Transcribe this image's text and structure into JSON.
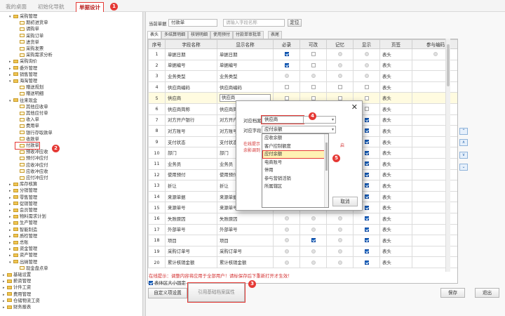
{
  "topbar": {
    "tabs": [
      {
        "label": "我的桌面"
      },
      {
        "label": "初始化导航"
      },
      {
        "label": "单据设计"
      }
    ]
  },
  "markers": [
    "1",
    "2",
    "3",
    "4",
    "5"
  ],
  "tree": [
    {
      "label": "采购管理",
      "level": 1,
      "folder": true,
      "open": true
    },
    {
      "label": "期初进货单",
      "level": 2
    },
    {
      "label": "请购单",
      "level": 2
    },
    {
      "label": "采购订单",
      "level": 2
    },
    {
      "label": "进货单",
      "level": 2
    },
    {
      "label": "采购发票",
      "level": 2
    },
    {
      "label": "采购需求分析",
      "level": 2
    },
    {
      "label": "采购询价",
      "level": 1,
      "folder": true
    },
    {
      "label": "委外管理",
      "level": 1,
      "folder": true
    },
    {
      "label": "销售管理",
      "level": 1,
      "folder": true
    },
    {
      "label": "海淘管理",
      "level": 1,
      "folder": true,
      "open": true
    },
    {
      "label": "赠送规划",
      "level": 2
    },
    {
      "label": "赠送明细",
      "level": 2
    },
    {
      "label": "往来现金",
      "level": 1,
      "folder": true,
      "open": true
    },
    {
      "label": "其他应收单",
      "level": 2
    },
    {
      "label": "其他应付单",
      "level": 2
    },
    {
      "label": "收入单",
      "level": 2
    },
    {
      "label": "费用单",
      "level": 2
    },
    {
      "label": "银行存取款单",
      "level": 2
    },
    {
      "label": "收款单",
      "level": 2
    },
    {
      "label": "付款单",
      "level": 2,
      "highlight": true
    },
    {
      "label": "预收冲应收",
      "level": 2
    },
    {
      "label": "预付冲应付",
      "level": 2
    },
    {
      "label": "应收冲应付",
      "level": 2
    },
    {
      "label": "应收冲应收",
      "level": 2
    },
    {
      "label": "应付冲应付",
      "level": 2
    },
    {
      "label": "库存核算",
      "level": 1,
      "folder": true
    },
    {
      "label": "分销管理",
      "level": 1,
      "folder": true
    },
    {
      "label": "零售管理",
      "level": 1,
      "folder": true
    },
    {
      "label": "促销管理",
      "level": 1,
      "folder": true
    },
    {
      "label": "会员管理",
      "level": 1,
      "folder": true
    },
    {
      "label": "物料需求计划",
      "level": 1,
      "folder": true
    },
    {
      "label": "生产管理",
      "level": 1,
      "folder": true
    },
    {
      "label": "智能制造",
      "level": 1,
      "folder": true
    },
    {
      "label": "质检管理",
      "level": 1,
      "folder": true
    },
    {
      "label": "总账",
      "level": 1,
      "folder": true
    },
    {
      "label": "资金管理",
      "level": 1,
      "folder": true
    },
    {
      "label": "资产管理",
      "level": 1,
      "folder": true
    },
    {
      "label": "出纳管理",
      "level": 1,
      "folder": true,
      "open": true
    },
    {
      "label": "现金盘点单",
      "level": 2
    },
    {
      "label": "基础设置",
      "level": 0,
      "folder": true
    },
    {
      "label": "薪资管理",
      "level": 0,
      "folder": true
    },
    {
      "label": "计件工资",
      "level": 0,
      "folder": true
    },
    {
      "label": "费用管理",
      "level": 0,
      "folder": true
    },
    {
      "label": "仓储物流工资",
      "level": 0,
      "folder": true
    },
    {
      "label": "财务报表",
      "level": 0,
      "folder": true
    }
  ],
  "main": {
    "doc_type_label": "当前单据",
    "doc_type_value": "付款单",
    "search_placeholder": "请输入字段名称",
    "locate_button": "定位",
    "subtabs": [
      "表头",
      "多结算明细",
      "核销明细",
      "使用预付",
      "付款单审批单",
      "表尾"
    ],
    "columns": [
      "序号",
      "字段名称",
      "显示名称",
      "必录",
      "可改",
      "记忆",
      "显示",
      "页签",
      "参与编码"
    ],
    "rows": [
      {
        "no": "1",
        "field": "单据日期",
        "display": "单据日期",
        "req": "on",
        "edit": "",
        "mem": "dis",
        "show": "dis",
        "tab": "表头",
        "code": "dis"
      },
      {
        "no": "2",
        "field": "单据编号",
        "display": "单据编号",
        "req": "on",
        "edit": "",
        "mem": "dis",
        "show": "dis",
        "tab": "表头",
        "code": ""
      },
      {
        "no": "3",
        "field": "业务类型",
        "display": "业务类型",
        "req": "dis",
        "edit": "dis",
        "mem": "dis",
        "show": "dis",
        "tab": "表头",
        "code": ""
      },
      {
        "no": "4",
        "field": "供应商编码",
        "display": "供应商编码",
        "req": "",
        "edit": "",
        "mem": "",
        "show": "",
        "tab": "表头",
        "code": ""
      },
      {
        "no": "5",
        "field": "供应商",
        "display": "供应商",
        "req": "",
        "edit": "",
        "mem": "",
        "show": "",
        "tab": "表头",
        "code": "",
        "selected": true
      },
      {
        "no": "6",
        "field": "供应商简称",
        "display": "供应商简称",
        "req": "",
        "edit": "",
        "mem": "",
        "show": "",
        "tab": "表头",
        "code": ""
      },
      {
        "no": "7",
        "field": "对方开户银行",
        "display": "对方开户银行",
        "req": "",
        "edit": "",
        "mem": "",
        "show": "on",
        "tab": "表头",
        "code": ""
      },
      {
        "no": "8",
        "field": "对方账号",
        "display": "对方账号",
        "req": "",
        "edit": "",
        "mem": "",
        "show": "on",
        "tab": "表头",
        "code": ""
      },
      {
        "no": "9",
        "field": "支付状态",
        "display": "支付状态",
        "req": "",
        "edit": "",
        "mem": "",
        "show": "on",
        "tab": "表头",
        "code": ""
      },
      {
        "no": "10",
        "field": "部门",
        "display": "部门",
        "req": "",
        "edit": "",
        "mem": "",
        "show": "on",
        "tab": "表头",
        "code": ""
      },
      {
        "no": "11",
        "field": "业务员",
        "display": "业务员",
        "req": "",
        "edit": "",
        "mem": "",
        "show": "on",
        "tab": "表头",
        "code": ""
      },
      {
        "no": "12",
        "field": "使用预付",
        "display": "使用预付",
        "req": "",
        "edit": "",
        "mem": "",
        "show": "on",
        "tab": "表头",
        "code": ""
      },
      {
        "no": "13",
        "field": "折让",
        "display": "折让",
        "req": "",
        "edit": "",
        "mem": "",
        "show": "on",
        "tab": "表头",
        "code": ""
      },
      {
        "no": "14",
        "field": "来源单据",
        "display": "来源单据",
        "req": "",
        "edit": "",
        "mem": "",
        "show": "on",
        "tab": "表头",
        "code": ""
      },
      {
        "no": "15",
        "field": "来源单号",
        "display": "来源单号",
        "req": "",
        "edit": "",
        "mem": "",
        "show": "on",
        "tab": "表头",
        "code": ""
      },
      {
        "no": "16",
        "field": "失败原因",
        "display": "失败原因",
        "req": "dis",
        "edit": "dis",
        "mem": "dis",
        "show": "on",
        "tab": "表头",
        "code": ""
      },
      {
        "no": "17",
        "field": "外部单号",
        "display": "外部单号",
        "req": "dis",
        "edit": "dis",
        "mem": "dis",
        "show": "on",
        "tab": "表头",
        "code": ""
      },
      {
        "no": "18",
        "field": "项目",
        "display": "项目",
        "req": "dis",
        "edit": "on",
        "mem": "dis",
        "show": "on",
        "tab": "表头",
        "code": ""
      },
      {
        "no": "19",
        "field": "采购订单号",
        "display": "采购订单号",
        "req": "dis",
        "edit": "dis",
        "mem": "dis",
        "show": "on",
        "tab": "表头",
        "code": ""
      },
      {
        "no": "20",
        "field": "累计核销金额",
        "display": "累计核销金额",
        "req": "dis",
        "edit": "dis",
        "mem": "dis",
        "show": "on",
        "tab": "表头",
        "code": ""
      }
    ],
    "hint": "在线提示：调整内容将应用于全部用户！请标保存后下重新打开才生效！",
    "checkbox_label": "表体区大小固定",
    "custom_button": "自定义项设置",
    "ref_button": "引用基础档案属性",
    "save_button": "保存",
    "exit_button": "退出",
    "side_arrows": [
      "⌃",
      "∧",
      "∨",
      "⌄"
    ]
  },
  "dialog": {
    "archive_label": "对应档案",
    "archive_value": "供应商",
    "field_label": "对应字段",
    "field_value": "应付余额",
    "warn_left": "在线提示",
    "warn_left2": "余影调到",
    "warn_right": "启",
    "options": [
      "应收余额",
      "客户控制额度",
      "应付余额",
      "电商账号",
      "停用",
      "参与营销活销",
      "所属辖区"
    ],
    "active_option": "应付余额",
    "cancel_button": "取消"
  }
}
